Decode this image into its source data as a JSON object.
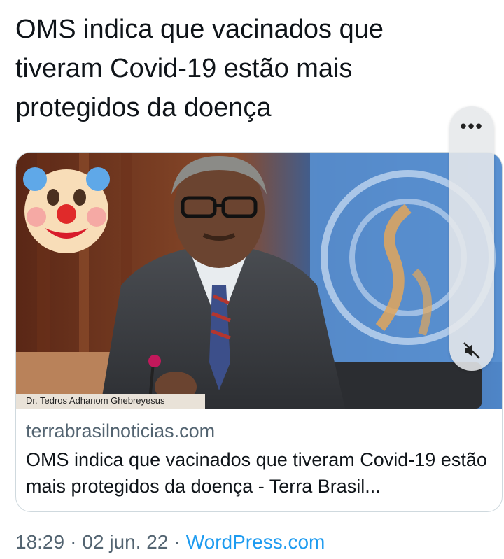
{
  "tweet": {
    "text": "OMS indica que vacinados que tiveram Covid-19 estão mais protegidos da doença"
  },
  "card": {
    "image_caption": "Dr. Tedros Adhanom Ghebreyesus",
    "domain": "terrabrasilnoticias.com",
    "title": "OMS indica que vacinados que tiveram Covid-19 estão mais protegidos da doença - Terra Brasil..."
  },
  "meta": {
    "time": "18:29",
    "date": "02 jun. 22",
    "separator": "·",
    "source": "WordPress.com"
  },
  "overlay": {
    "more_icon": "more-horizontal-icon",
    "mute_icon": "speaker-muted-icon"
  },
  "sticker": {
    "icon": "clown-face-emoji"
  },
  "colors": {
    "text": "#0f1419",
    "secondary": "#536471",
    "link": "#1d9bf0",
    "card_border": "#cfd9de"
  }
}
